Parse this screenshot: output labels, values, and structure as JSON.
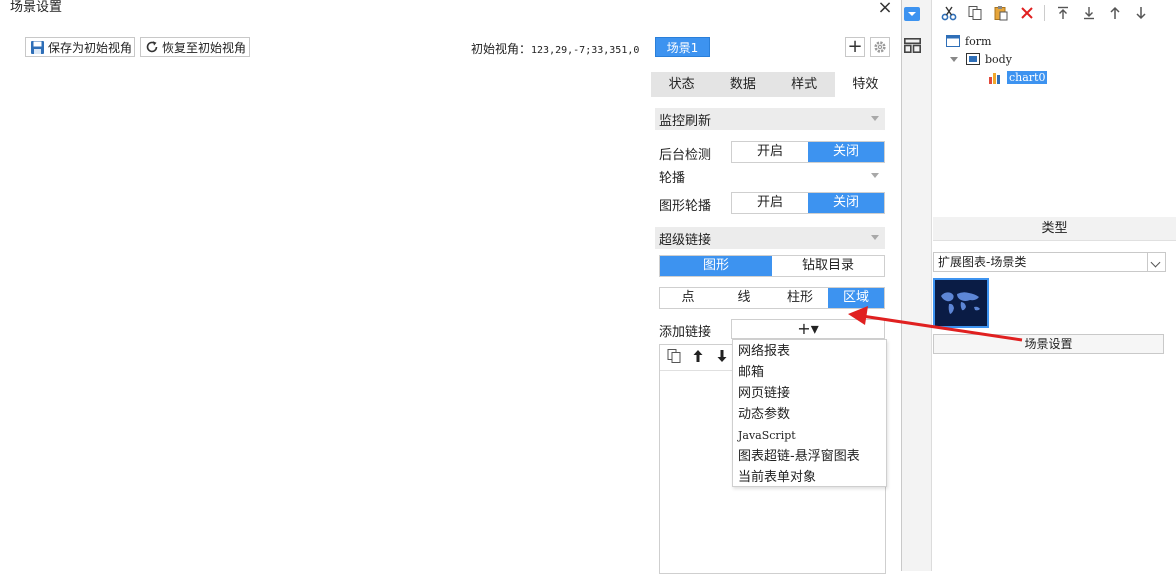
{
  "dialog": {
    "title": "场景设置",
    "close_icon": "×",
    "save_view_label": "保存为初始视角",
    "restore_view_label": "恢复至初始视角",
    "init_view_label": "初始视角：",
    "init_view_value": "123,29,-7;33,351,0",
    "scene_tab_label": "场景1"
  },
  "tabs": [
    {
      "label": "状态",
      "active": false
    },
    {
      "label": "数据",
      "active": false
    },
    {
      "label": "样式",
      "active": false
    },
    {
      "label": "特效",
      "active": true
    }
  ],
  "sections": {
    "monitor_refresh": "监控刷新",
    "carousel": "轮播",
    "hyperlink": "超级链接"
  },
  "settings": {
    "bg_detect_label": "后台检测",
    "shape_carousel_label": "图形轮播",
    "on_label": "开启",
    "off_label": "关闭"
  },
  "link_type": [
    {
      "label": "图形",
      "active": true
    },
    {
      "label": "钻取目录",
      "active": false
    }
  ],
  "shape_type": [
    {
      "label": "点",
      "active": false
    },
    {
      "label": "线",
      "active": false
    },
    {
      "label": "柱形",
      "active": false
    },
    {
      "label": "区域",
      "active": true
    }
  ],
  "add_link": {
    "label": "添加链接",
    "button_glyph": "+▾"
  },
  "dropdown_menu": [
    "网络报表",
    "邮箱",
    "网页链接",
    "动态参数",
    "JavaScript",
    "图表超链-悬浮窗图表",
    "当前表单对象"
  ],
  "tree": {
    "form_label": "form",
    "body_label": "body",
    "chart_label": "chart0"
  },
  "right_panel": {
    "type_header": "类型",
    "type_select_value": "扩展图表-场景类",
    "scene_settings_label": "场景设置"
  },
  "colors": {
    "accent": "#3d93f0",
    "arrow": "#e02020"
  },
  "icons": [
    "save-icon",
    "refresh-icon",
    "plus-icon",
    "gear-icon",
    "cut-icon",
    "copy-icon",
    "paste-icon",
    "delete-icon",
    "move-top-icon",
    "move-bottom-icon",
    "move-up-icon",
    "move-down-icon"
  ]
}
